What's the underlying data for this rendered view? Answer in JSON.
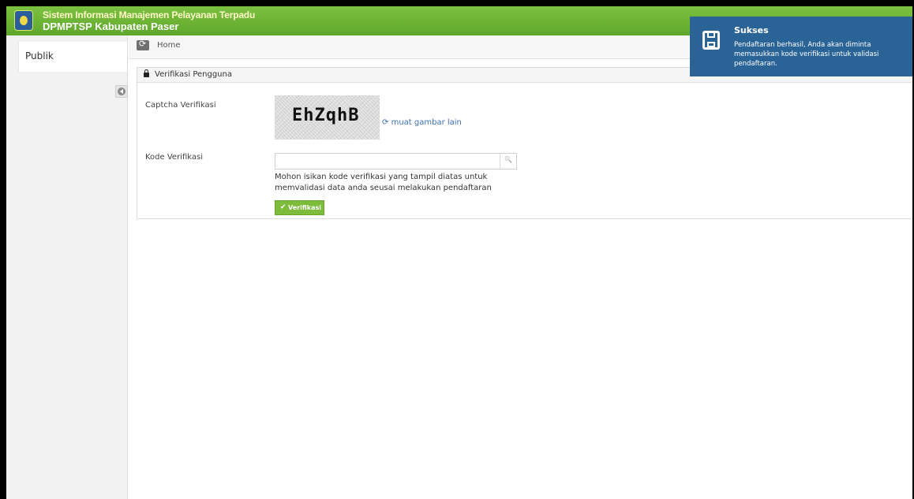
{
  "header": {
    "title_line1": "Sistem Informasi Manajemen Pelayanan Terpadu",
    "title_line2": "DPMPTSP Kabupaten Paser"
  },
  "sidebar": {
    "items": [
      {
        "label": "Publik"
      }
    ]
  },
  "breadcrumb": {
    "home_label": "Home"
  },
  "panel": {
    "title": "Verifikasi Pengguna",
    "captcha_label": "Captcha Verifikasi",
    "captcha_text": "EhZqhB",
    "reload_label": "muat gambar lain",
    "code_label": "Kode Verifikasi",
    "code_value": "",
    "help_text": "Mohon isikan kode verifikasi yang tampil diatas untuk memvalidasi data anda seusai melakukan pendaftaran",
    "verify_button": "Verifikasi"
  },
  "toast": {
    "title": "Sukses",
    "message": "Pendaftaran berhasil, Anda akan diminta memasukkan kode verifikasi untuk validasi pendaftaran."
  },
  "icons": [
    "logo",
    "collapse-icon",
    "home-icon",
    "lock-icon",
    "refresh-icon",
    "search-icon",
    "check-icon",
    "save-icon"
  ],
  "colors": {
    "header": "#6cb434",
    "toast": "#2a6496",
    "button": "#7dbb3a"
  }
}
